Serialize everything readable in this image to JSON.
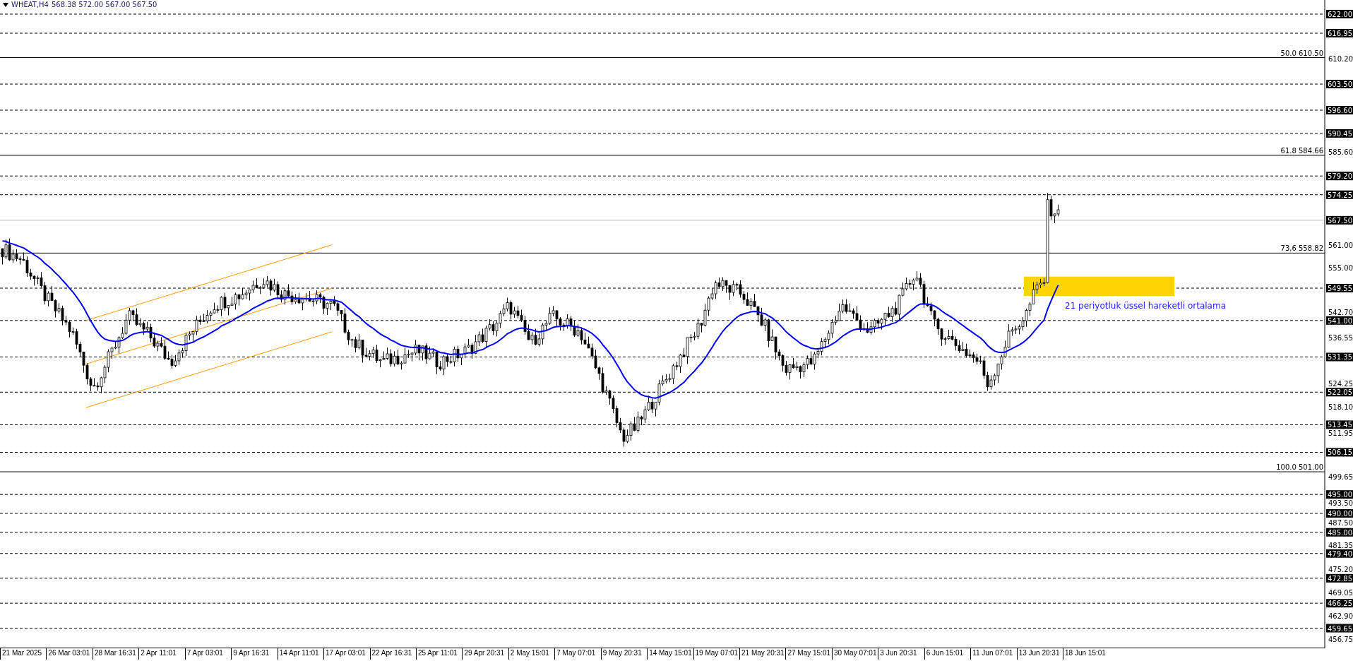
{
  "header": {
    "symbol": "WHEAT,H4",
    "quote": "568.38 572.00 567.00 567.50"
  },
  "levels": [
    {
      "kind": "dashed",
      "tag": "622.00"
    },
    {
      "kind": "dashed",
      "tag": "616.95"
    },
    {
      "kind": "fib",
      "tag": "50.0 610.50"
    },
    {
      "kind": "dashed",
      "tag": "603.50"
    },
    {
      "kind": "dashed",
      "tag": "596.60"
    },
    {
      "kind": "dashed",
      "tag": "590.45"
    },
    {
      "kind": "fib",
      "tag": "61.8 584.66"
    },
    {
      "kind": "dashed",
      "tag": "579.20"
    },
    {
      "kind": "dashed",
      "tag": "574.25"
    },
    {
      "kind": "current",
      "tag": "567.50"
    },
    {
      "kind": "fib",
      "tag": "73,6 558.82"
    },
    {
      "kind": "dashed",
      "tag": "549.55"
    },
    {
      "kind": "dashed",
      "tag": "541.00"
    },
    {
      "kind": "dashed",
      "tag": "531.35"
    },
    {
      "kind": "dashed",
      "tag": "522.05"
    },
    {
      "kind": "dashed",
      "tag": "513.45"
    },
    {
      "kind": "dashed",
      "tag": "506.15"
    },
    {
      "kind": "fib",
      "tag": "100.0 501.00"
    },
    {
      "kind": "dashed",
      "tag": "495.00"
    },
    {
      "kind": "dashed",
      "tag": "490.00"
    },
    {
      "kind": "dashed",
      "tag": "485.00"
    },
    {
      "kind": "dashed",
      "tag": "479.40"
    },
    {
      "kind": "dashed",
      "tag": "472.85"
    },
    {
      "kind": "dashed",
      "tag": "466.25"
    },
    {
      "kind": "dashed",
      "tag": "459.65"
    }
  ],
  "price_axis": [
    "610.20",
    "585.60",
    "561.00",
    "555.00",
    "542.70",
    "536.55",
    "524.25",
    "518.10",
    "511.95",
    "499.65",
    "493.50",
    "487.50",
    "481.35",
    "475.20",
    "469.05",
    "462.90",
    "456.75"
  ],
  "time_axis": [
    "21 Mar 2025",
    "26 Mar 03:01",
    "28 Mar 16:31",
    "2 Apr 11:01",
    "7 Apr 03:01",
    "9 Apr 16:31",
    "14 Apr 11:01",
    "17 Apr 03:01",
    "22 Apr 16:31",
    "25 Apr 11:01",
    "29 Apr 20:31",
    "2 May 15:01",
    "7 May 07:01",
    "9 May 20:31",
    "14 May 15:01",
    "19 May 07:01",
    "21 May 20:31",
    "27 May 15:01",
    "30 May 07:01",
    "3 Jun 20:31",
    "6 Jun 15:01",
    "11 Jun 07:01",
    "13 Jun 20:31",
    "18 Jun 15:01"
  ],
  "annotation": "21 periyotluk üssel hareketli ortalama"
}
